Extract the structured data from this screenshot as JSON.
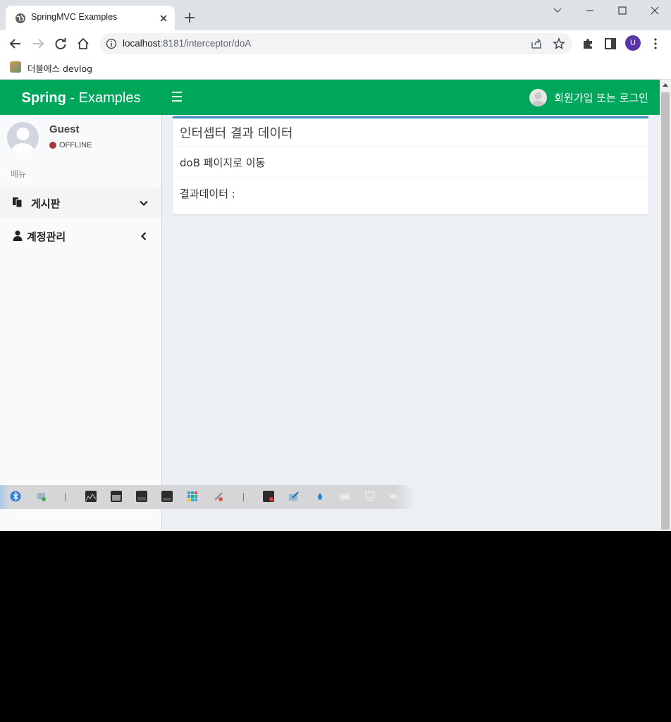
{
  "browser": {
    "tab_title": "SpringMVC Examples",
    "url_host": "localhost",
    "url_rest": ":8181/interceptor/doA",
    "profile_initial": "U",
    "bookmark_label": "더블에스 devlog"
  },
  "app": {
    "logo_bold": "Spring",
    "logo_rest": " - Examples",
    "user_menu_label": "회원가입 또는 로그인"
  },
  "sidebar": {
    "user_name": "Guest",
    "user_status": "OFFLINE",
    "menu_header": "메뉴",
    "items": [
      {
        "label": "게시판",
        "icon": "copy-icon",
        "arrow": "chevron-down-icon"
      },
      {
        "label": "계정관리",
        "icon": "user-icon",
        "arrow": "chevron-left-icon"
      }
    ]
  },
  "content": {
    "box_title": "인터셉터 결과 데이터",
    "row1": "doB 페이지로 이동",
    "row2": "결과데이터 :"
  },
  "colors": {
    "header_green": "#00a65a",
    "box_top_border": "#3c8dbc",
    "offline_dot": "#a33a3a",
    "page_bg": "#ecf0f5"
  }
}
